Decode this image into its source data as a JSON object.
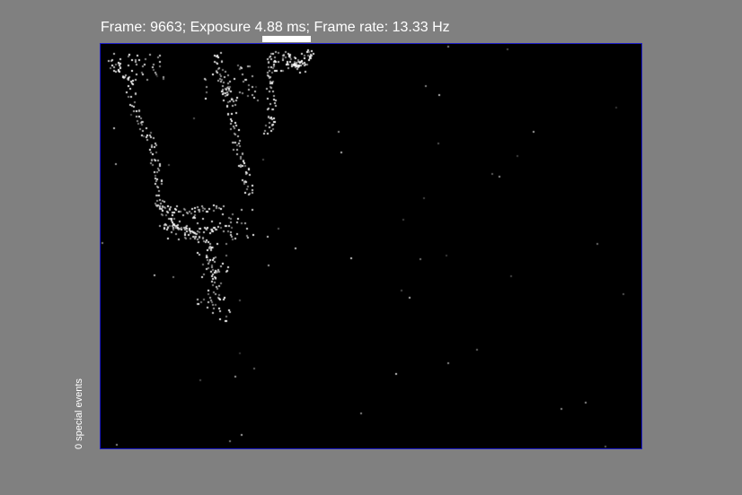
{
  "status": {
    "text": "Frame: 9663; Exposure 4.88 ms; Frame rate: 13.33 Hz"
  },
  "exposure_indicator": {
    "color": "#ffffff"
  },
  "display": {
    "background_color": "#000000",
    "border_color": "#1c1cc8",
    "pixel_color": "#ffffff"
  },
  "side_panel": {
    "special_events_label": "0 special events"
  },
  "colors": {
    "window_background": "#808080"
  }
}
